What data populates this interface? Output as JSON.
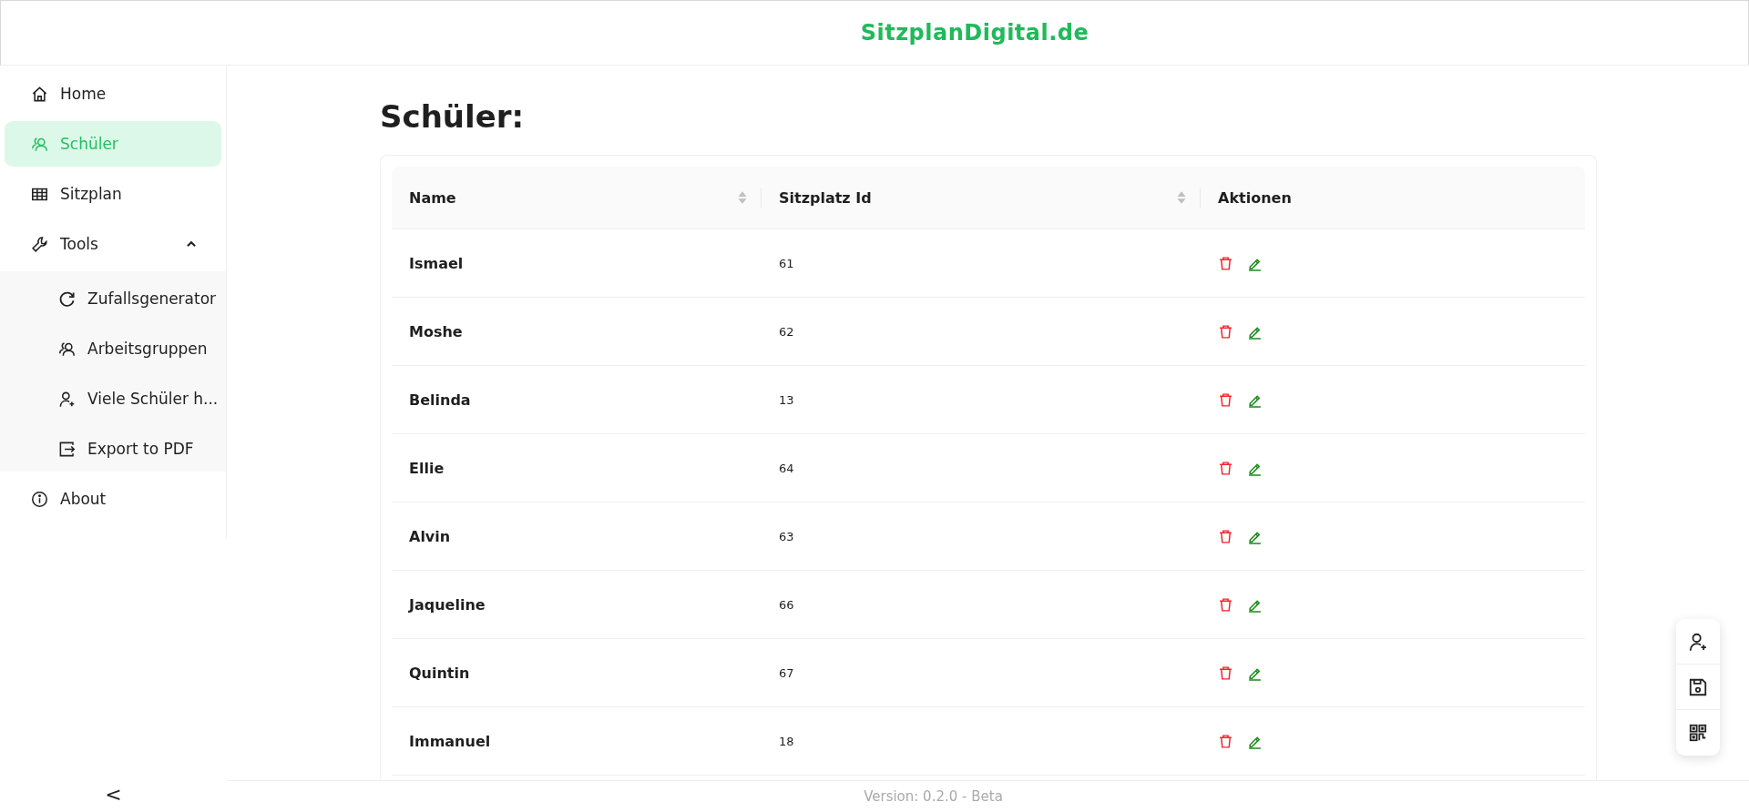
{
  "header": {
    "title": "SitzplanDigital.de"
  },
  "sidebar": {
    "items": [
      {
        "label": "Home",
        "selected": false
      },
      {
        "label": "Schüler",
        "selected": true
      },
      {
        "label": "Sitzplan",
        "selected": false
      },
      {
        "label": "Tools",
        "selected": false,
        "expanded": true,
        "children": [
          {
            "label": "Zufallsgenerator",
            "selected": false
          },
          {
            "label": "Arbeitsgruppen",
            "selected": false
          },
          {
            "label": "Viele Schüler h...",
            "selected": false
          },
          {
            "label": "Export to PDF",
            "selected": false
          }
        ]
      },
      {
        "label": "About",
        "selected": false
      }
    ],
    "collapse": "<"
  },
  "page": {
    "title": "Schüler:"
  },
  "table": {
    "columns": [
      {
        "label": "Name",
        "sortable": true
      },
      {
        "label": "Sitzplatz Id",
        "sortable": true
      },
      {
        "label": "Aktionen",
        "sortable": false
      }
    ],
    "rows": [
      {
        "name": "Ismael",
        "seat": "61"
      },
      {
        "name": "Moshe",
        "seat": "62"
      },
      {
        "name": "Belinda",
        "seat": "13"
      },
      {
        "name": "Ellie",
        "seat": "64"
      },
      {
        "name": "Alvin",
        "seat": "63"
      },
      {
        "name": "Jaqueline",
        "seat": "66"
      },
      {
        "name": "Quintin",
        "seat": "67"
      },
      {
        "name": "Immanuel",
        "seat": "18"
      }
    ]
  },
  "footer": {
    "text": "Version: 0.2.0 - Beta"
  }
}
